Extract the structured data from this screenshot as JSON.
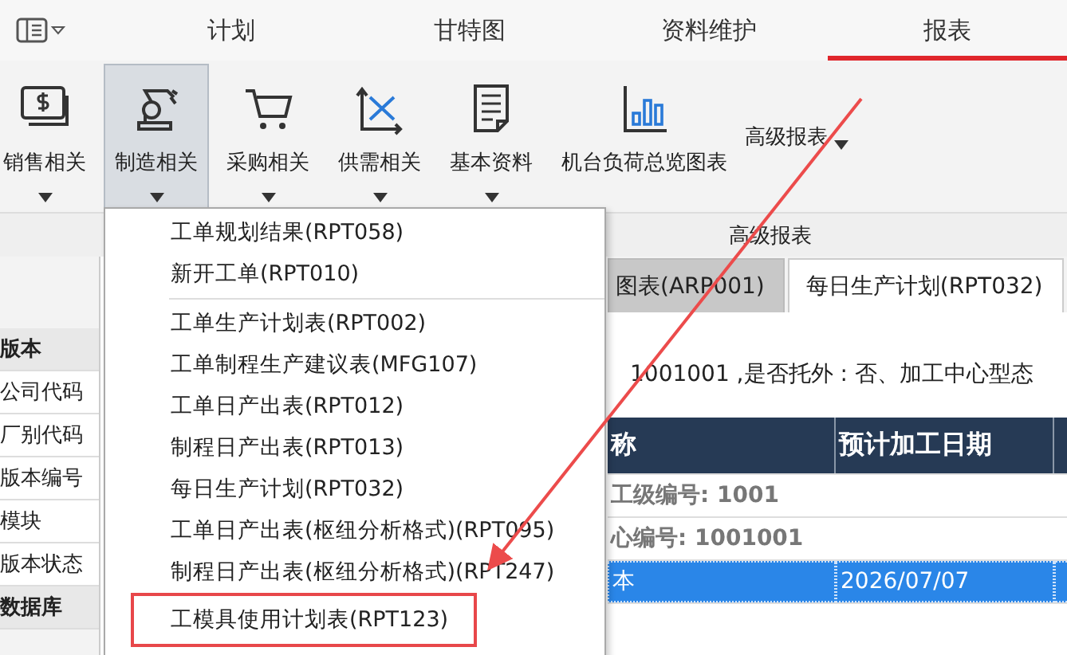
{
  "top_tabs": [
    {
      "label": "计划",
      "selected": false
    },
    {
      "label": "甘特图",
      "selected": false
    },
    {
      "label": "资料维护",
      "selected": false
    },
    {
      "label": "报表",
      "selected": true
    }
  ],
  "ribbon": {
    "buttons": [
      {
        "label": "销售相关",
        "has_menu": true,
        "pressed": false
      },
      {
        "label": "制造相关",
        "has_menu": true,
        "pressed": true
      },
      {
        "label": "采购相关",
        "has_menu": true,
        "pressed": false
      },
      {
        "label": "供需相关",
        "has_menu": true,
        "pressed": false
      },
      {
        "label": "基本资料",
        "has_menu": true,
        "pressed": false
      },
      {
        "label": "机台负荷总览图表",
        "has_menu": false,
        "pressed": false
      }
    ],
    "dropdown_label": "高级报表",
    "group_label": "高级报表"
  },
  "sidebar": {
    "rows": [
      {
        "label": "版本",
        "kind": "header"
      },
      {
        "label": "公司代码",
        "kind": "field"
      },
      {
        "label": "厂别代码",
        "kind": "field"
      },
      {
        "label": "版本编号",
        "kind": "field"
      },
      {
        "label": "模块",
        "kind": "field"
      },
      {
        "label": "版本状态",
        "kind": "field"
      },
      {
        "label": "数据库",
        "kind": "header"
      }
    ]
  },
  "doc_tabs": [
    {
      "label": "图表(ARP001)",
      "selected": false
    },
    {
      "label": "每日生产计划(RPT032)",
      "selected": true
    }
  ],
  "filter_text": "1001001 ,是否托外 : 否、加工中心型态",
  "table": {
    "columns": [
      "称",
      "预计加工日期"
    ],
    "rows": [
      {
        "kind": "group",
        "cells": [
          "工级编号: 1001"
        ],
        "selected": false
      },
      {
        "kind": "group",
        "cells": [
          "心编号: 1001001"
        ],
        "selected": false
      },
      {
        "kind": "data",
        "cells": [
          "本",
          "2026/07/07"
        ],
        "selected": true
      }
    ]
  },
  "menu": {
    "items": [
      {
        "label": "工单规划结果(RPT058)",
        "separator_after": false,
        "annotated": false
      },
      {
        "label": "新开工单(RPT010)",
        "separator_after": true,
        "annotated": false
      },
      {
        "label": "工单生产计划表(RPT002)",
        "separator_after": false,
        "annotated": false
      },
      {
        "label": "工单制程生产建议表(MFG107)",
        "separator_after": false,
        "annotated": false
      },
      {
        "label": "工单日产出表(RPT012)",
        "separator_after": false,
        "annotated": false
      },
      {
        "label": "制程日产出表(RPT013)",
        "separator_after": false,
        "annotated": false
      },
      {
        "label": "每日生产计划(RPT032)",
        "separator_after": false,
        "annotated": false
      },
      {
        "label": "工单日产出表(枢纽分析格式)(RPT095)",
        "separator_after": false,
        "annotated": false
      },
      {
        "label": "制程日产出表(枢纽分析格式)(RPT247)",
        "separator_after": false,
        "annotated": false
      },
      {
        "label": "工模具使用计划表(RPT123)",
        "separator_after": false,
        "annotated": true
      }
    ]
  }
}
